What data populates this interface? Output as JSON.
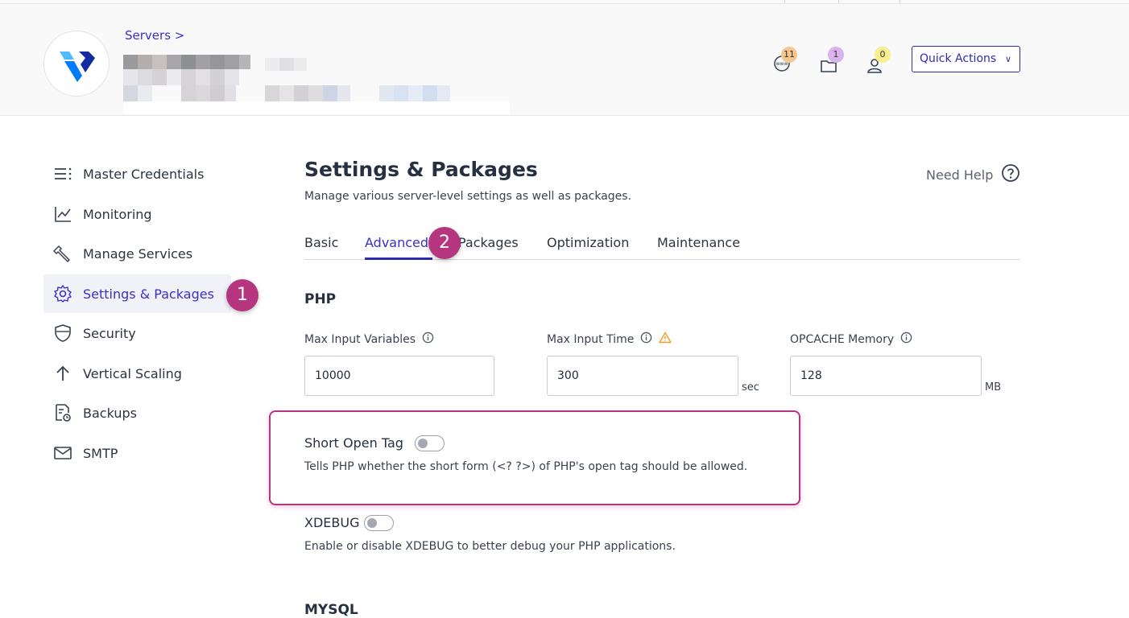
{
  "header": {
    "breadcrumb": "Servers >",
    "badges": [
      {
        "icon": "www-icon",
        "count": "11",
        "color": "#f7c58e"
      },
      {
        "icon": "folder-icon",
        "count": "1",
        "color": "#d9b3ee"
      },
      {
        "icon": "user-icon",
        "count": "0",
        "color": "#f7ee8e"
      }
    ],
    "quick_actions": "Quick Actions"
  },
  "sidebar": {
    "items": [
      {
        "label": "Master Credentials",
        "icon": "list-icon"
      },
      {
        "label": "Monitoring",
        "icon": "chart-line-icon"
      },
      {
        "label": "Manage Services",
        "icon": "wrench-icon"
      },
      {
        "label": "Settings & Packages",
        "icon": "gear-icon",
        "active": true
      },
      {
        "label": "Security",
        "icon": "shield-icon"
      },
      {
        "label": "Vertical Scaling",
        "icon": "arrow-up-icon"
      },
      {
        "label": "Backups",
        "icon": "backup-icon"
      },
      {
        "label": "SMTP",
        "icon": "mail-icon"
      }
    ]
  },
  "markers": {
    "one": "1",
    "two": "2"
  },
  "main": {
    "title": "Settings & Packages",
    "subtitle": "Manage various server-level settings as well as packages.",
    "help": "Need Help",
    "tabs": [
      "Basic",
      "Advanced",
      "Packages",
      "Optimization",
      "Maintenance"
    ],
    "active_tab": "Advanced",
    "php": {
      "heading": "PHP",
      "fields": [
        {
          "label": "Max Input Variables",
          "value": "10000",
          "unit": ""
        },
        {
          "label": "Max Input Time",
          "value": "300",
          "unit": "sec"
        },
        {
          "label": "OPCACHE Memory",
          "value": "128",
          "unit": "MB"
        }
      ],
      "short_open_tag": {
        "title": "Short Open Tag",
        "description": "Tells PHP whether the short form (<? ?>) of PHP's open tag should be allowed.",
        "enabled": false
      },
      "xdebug": {
        "title": "XDEBUG",
        "description": "Enable or disable XDEBUG to better debug your PHP applications.",
        "enabled": false
      }
    },
    "mysql_heading": "MYSQL"
  }
}
